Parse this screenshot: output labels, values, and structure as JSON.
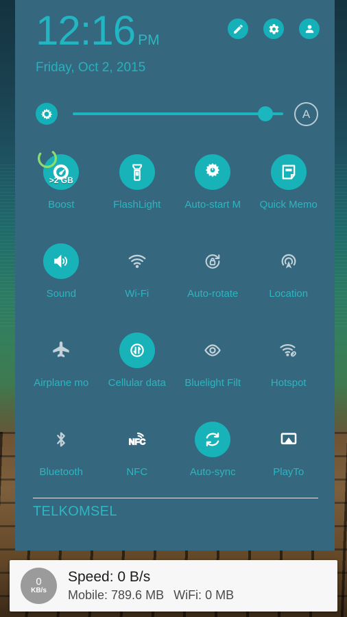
{
  "status": {
    "panel_bg": "#35687e",
    "accent_on": "#17b3b9",
    "label_color": "#2cb5c1",
    "boost_ring_color": "#8ade6d"
  },
  "header": {
    "time": "12:16",
    "ampm": "PM",
    "date": "Friday, Oct 2, 2015",
    "buttons": [
      {
        "name": "edit-button",
        "icon": "pencil-icon"
      },
      {
        "name": "settings-button",
        "icon": "gear-icon"
      },
      {
        "name": "profile-button",
        "icon": "user-icon"
      }
    ]
  },
  "brightness": {
    "icon": "brightness-icon",
    "value_percent": 88,
    "auto_label": "A"
  },
  "tiles": [
    {
      "label": "Boost",
      "icon": "boost-gauge-icon",
      "state": "on",
      "badge": ">2 GB",
      "ring_percent": 72
    },
    {
      "label": "FlashLight",
      "icon": "flashlight-icon",
      "state": "on"
    },
    {
      "label": "Auto-start M",
      "icon": "autostart-gear-icon",
      "state": "on"
    },
    {
      "label": "Quick Memo",
      "icon": "memo-icon",
      "state": "on"
    },
    {
      "label": "Sound",
      "icon": "speaker-icon",
      "state": "on"
    },
    {
      "label": "Wi-Fi",
      "icon": "wifi-icon",
      "state": "off"
    },
    {
      "label": "Auto-rotate",
      "icon": "rotate-lock-icon",
      "state": "off"
    },
    {
      "label": "Location",
      "icon": "location-icon",
      "state": "off"
    },
    {
      "label": "Airplane mo",
      "icon": "airplane-icon",
      "state": "off"
    },
    {
      "label": "Cellular data",
      "icon": "cellular-data-icon",
      "state": "on"
    },
    {
      "label": "Bluelight Filt",
      "icon": "eye-icon",
      "state": "off"
    },
    {
      "label": "Hotspot",
      "icon": "hotspot-icon",
      "state": "off"
    },
    {
      "label": "Bluetooth",
      "icon": "bluetooth-icon",
      "state": "off"
    },
    {
      "label": "NFC",
      "icon": "nfc-icon",
      "state": "white"
    },
    {
      "label": "Auto-sync",
      "icon": "sync-icon",
      "state": "on"
    },
    {
      "label": "PlayTo",
      "icon": "cast-icon",
      "state": "white"
    }
  ],
  "carrier": "TELKOMSEL",
  "notification": {
    "badge_value": "0",
    "badge_unit": "KB/s",
    "title": "Speed: 0 B/s",
    "mobile": "Mobile: 789.6 MB",
    "wifi": "WiFi: 0 MB"
  }
}
